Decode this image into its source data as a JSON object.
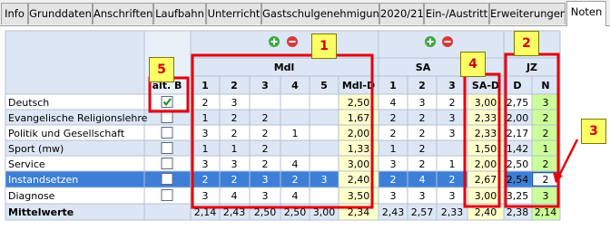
{
  "tabs": [
    "Info",
    "Grunddaten",
    "Anschriften",
    "Laufbahn",
    "Unterricht",
    "Gastschulgenehmigung",
    "2020/21",
    "Ein-/Austritt",
    "Erweiterungen",
    "Noten"
  ],
  "active_tab": "Noten",
  "headers": {
    "alt_b": "alt. B",
    "mdl_group": "Mdl",
    "sa_group": "SA",
    "jz_group": "JZ",
    "mdl_cols": [
      "1",
      "2",
      "3",
      "4",
      "5",
      "Mdl-D"
    ],
    "sa_cols": [
      "1",
      "2",
      "3",
      "SA-D"
    ],
    "jz_cols": [
      "D",
      "N"
    ]
  },
  "rows": [
    {
      "subject": "Deutsch",
      "alt_b": true,
      "mdl": [
        "2",
        "3",
        "",
        "",
        "",
        "2,50"
      ],
      "sa": [
        "4",
        "3",
        "2",
        "3,00"
      ],
      "jz": [
        "2,75",
        "3"
      ]
    },
    {
      "subject": "Evangelische Religionslehre",
      "alt_b": false,
      "mdl": [
        "1",
        "2",
        "2",
        "",
        "",
        "1,67"
      ],
      "sa": [
        "2",
        "2",
        "3",
        "2,33"
      ],
      "jz": [
        "2,00",
        "2"
      ]
    },
    {
      "subject": "Politik und Gesellschaft",
      "alt_b": false,
      "mdl": [
        "3",
        "2",
        "2",
        "1",
        "",
        "2,00"
      ],
      "sa": [
        "2",
        "2",
        "3",
        "2,33"
      ],
      "jz": [
        "2,17",
        "2"
      ]
    },
    {
      "subject": "Sport (mw)",
      "alt_b": false,
      "mdl": [
        "1",
        "1",
        "2",
        "",
        "",
        "1,33"
      ],
      "sa": [
        "1",
        "2",
        "",
        "1,50"
      ],
      "jz": [
        "1,42",
        "1"
      ]
    },
    {
      "subject": "Service",
      "alt_b": false,
      "mdl": [
        "3",
        "3",
        "2",
        "4",
        "",
        "3,00"
      ],
      "sa": [
        "3",
        "2",
        "1",
        "2,00"
      ],
      "jz": [
        "2,50",
        "2"
      ]
    },
    {
      "subject": "Instandsetzen",
      "alt_b": false,
      "mdl": [
        "2",
        "2",
        "3",
        "2",
        "3",
        "2,40"
      ],
      "sa": [
        "2",
        "4",
        "2",
        "2,67"
      ],
      "jz": [
        "2,54",
        "2"
      ]
    },
    {
      "subject": "Diagnose",
      "alt_b": false,
      "mdl": [
        "3",
        "4",
        "3",
        "4",
        "",
        "3,50"
      ],
      "sa": [
        "3",
        "3",
        "3",
        "3,00"
      ],
      "jz": [
        "3,25",
        "3"
      ]
    }
  ],
  "footer": {
    "label": "Mittelwerte",
    "mdl": [
      "2,14",
      "2,43",
      "2,50",
      "2,50",
      "3,00",
      "2,34"
    ],
    "sa": [
      "2,43",
      "2,57",
      "2,33",
      "2,40"
    ],
    "jz": [
      "2,38",
      "2,14"
    ]
  },
  "callouts": [
    "1",
    "2",
    "3",
    "4",
    "5"
  ],
  "colors": {
    "avg_fill": "#ffffcc",
    "n_fill": "#ccff99",
    "selected_row": "#3d7fd6",
    "alt_row": "#dce6f4",
    "highlight": "#e3000f",
    "callout_fill": "#ffff66",
    "add_icon": "#3ca83c",
    "remove_icon": "#d83a3a"
  }
}
